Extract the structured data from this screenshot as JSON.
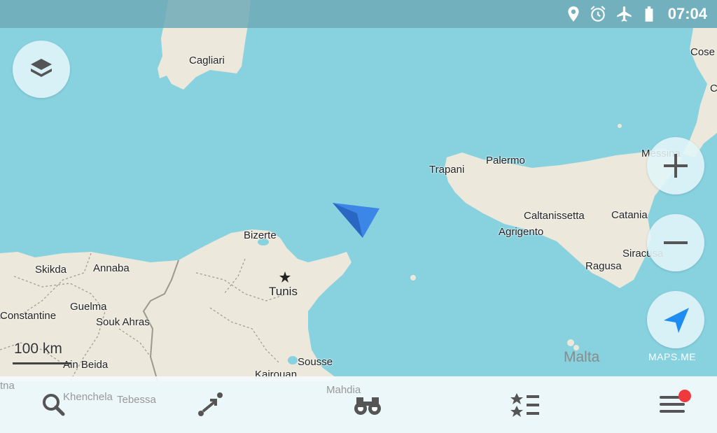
{
  "status_bar": {
    "time": "07:04",
    "icons": [
      "location-pin-icon",
      "alarm-clock-icon",
      "airplane-mode-icon",
      "battery-icon"
    ]
  },
  "map": {
    "colors": {
      "sea": "#88d2e0",
      "land": "#ece8dc",
      "border": "#9a9a8a",
      "water_body": "#88d2e0"
    },
    "labels": {
      "cagliari": "Cagliari",
      "cosenza": "Cose",
      "crotone": "C",
      "messina": "Messina",
      "trapani": "Trapani",
      "palermo": "Palermo",
      "caltanissetta": "Caltanissetta",
      "catania": "Catania",
      "agrigento": "Agrigento",
      "siracusa": "Siracusa",
      "ragusa": "Ragusa",
      "malta": "Malta",
      "bizerte": "Bizerte",
      "tunis": "Tunis",
      "skikda": "Skikda",
      "annaba": "Annaba",
      "guelma": "Guelma",
      "constantine": "Constantine",
      "souk_ahras": "Souk Ahras",
      "ain_beida": "Ain Beida",
      "sousse": "Sousse",
      "kairouan": "Kairouan",
      "khenchela": "Khenchela",
      "tebessa": "Tebessa",
      "mahdia": "Mahdia",
      "batna": "tna"
    },
    "scale": "100 km",
    "brand": "MAPS.ME"
  },
  "controls": {
    "layers": "layers-icon",
    "zoom_in": "plus-icon",
    "zoom_out": "minus-icon",
    "my_position": "navigation-arrow-icon"
  },
  "bottom_bar": {
    "tabs": [
      "search-icon",
      "route-icon",
      "discovery-binoculars-icon",
      "bookmarks-icon",
      "menu-icon"
    ],
    "accent_color": "#f0393c"
  }
}
